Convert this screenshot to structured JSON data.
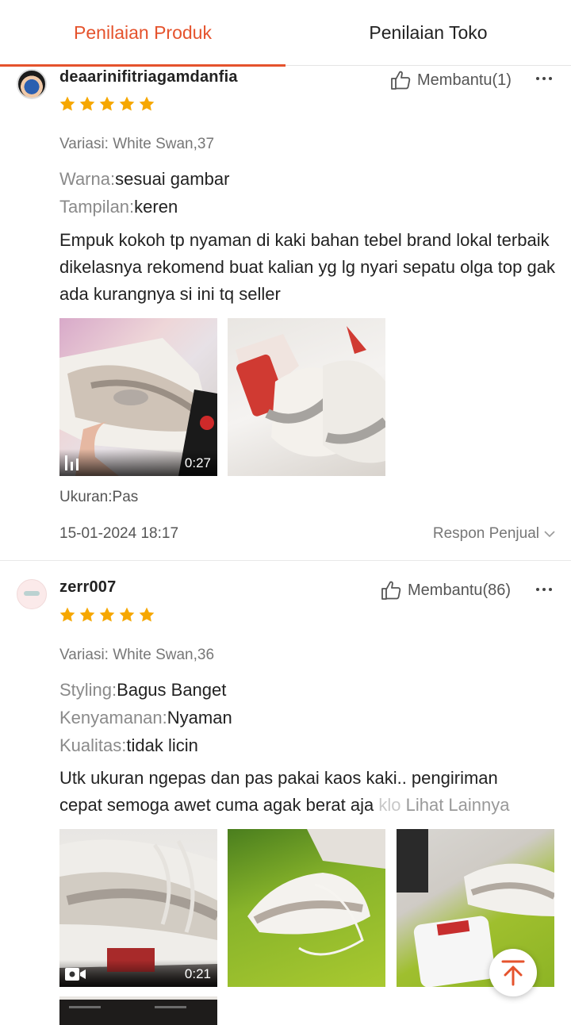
{
  "tabs": [
    {
      "label": "Penilaian Produk",
      "active": true
    },
    {
      "label": "Penilaian Toko",
      "active": false
    }
  ],
  "colors": {
    "accent": "#e5532d",
    "star": "#f6a700"
  },
  "reviews": [
    {
      "username": "deaarinifitriagamdanfia",
      "rating": 5,
      "helpful": "Membantu(1)",
      "variasi": "Variasi: White Swan,37",
      "attributes": [
        {
          "key": "Warna:",
          "value": "sesuai gambar"
        },
        {
          "key": "Tampilan:",
          "value": "keren"
        }
      ],
      "text": "Empuk kokoh tp nyaman di kaki bahan tebel brand lokal terbaik dikelasnya rekomend buat kalian yg lg nyari sepatu olga top gak ada kurangnya si ini tq seller",
      "media": [
        {
          "type": "video",
          "duration": "0:27"
        },
        {
          "type": "photo"
        }
      ],
      "ukuran": "Ukuran:Pas",
      "date": "15-01-2024 18:17",
      "respon": "Respon Penjual"
    },
    {
      "username": "zerr007",
      "rating": 5,
      "helpful": "Membantu(86)",
      "variasi": "Variasi: White Swan,36",
      "attributes": [
        {
          "key": "Styling:",
          "value": "Bagus Banget"
        },
        {
          "key": "Kenyamanan:",
          "value": "Nyaman"
        },
        {
          "key": "Kualitas:",
          "value": "tidak licin"
        }
      ],
      "text_line1": "Utk ukuran ngepas dan pas pakai kaos kaki.. pengiriman",
      "text_line2": "cepat semoga awet cuma agak berat aja ",
      "text_fade": "klo",
      "see_more": "Lihat Lainnya",
      "media": [
        {
          "type": "video",
          "duration": "0:21"
        },
        {
          "type": "photo"
        },
        {
          "type": "photo"
        },
        {
          "type": "photo"
        }
      ]
    }
  ],
  "icons": {
    "helpful": "thumbs-up-icon",
    "more": "more-dots-icon",
    "respon": "chevron-down-icon",
    "fab": "scroll-to-top-icon",
    "video1": "audio-bars-icon",
    "video2": "video-camera-icon"
  }
}
